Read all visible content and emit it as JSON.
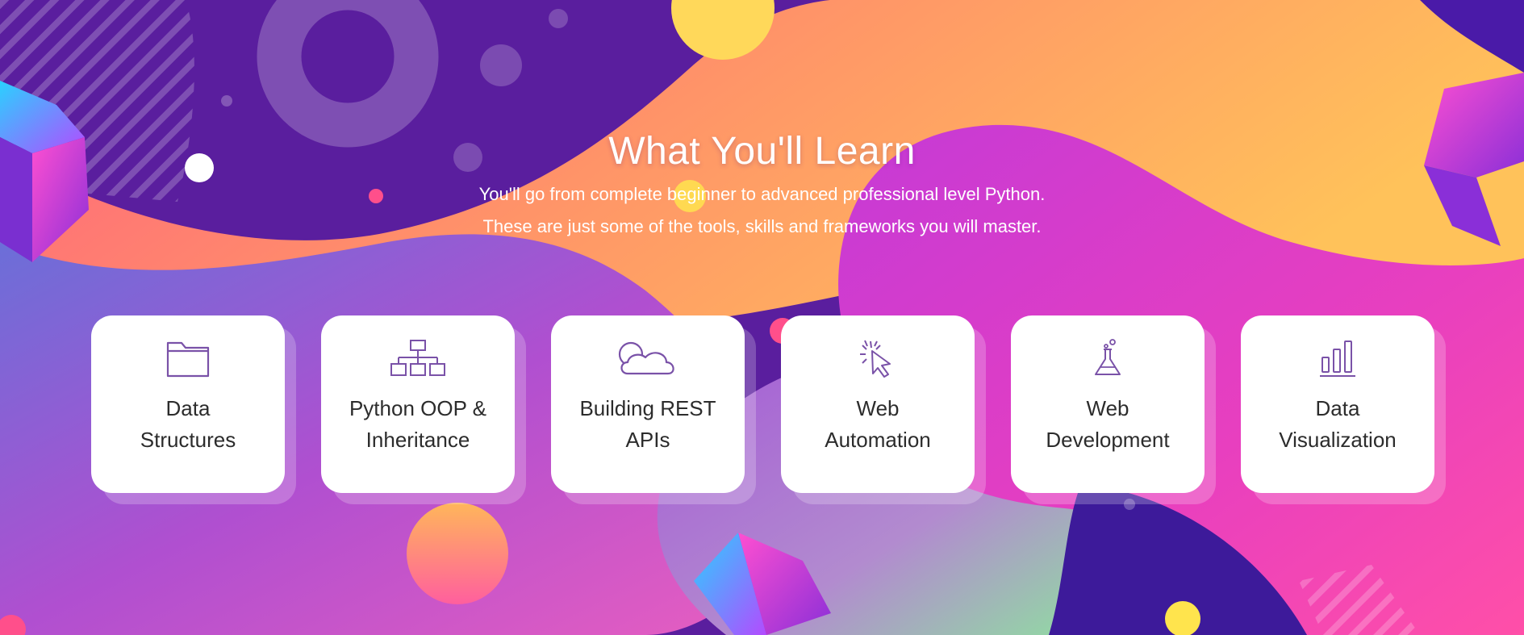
{
  "section": {
    "title": "What You'll Learn",
    "subtitle_line1": "You'll go from complete beginner to advanced professional level Python.",
    "subtitle_line2": "These are just some of the tools, skills and frameworks you will master."
  },
  "cards": [
    {
      "line1": "Data",
      "line2": "Structures",
      "icon": "folder-icon"
    },
    {
      "line1": "Python OOP &",
      "line2": "Inheritance",
      "icon": "hierarchy-icon"
    },
    {
      "line1": "Building REST",
      "line2": "APIs",
      "icon": "cloud-icon"
    },
    {
      "line1": "Web",
      "line2": "Automation",
      "icon": "cursor-click-icon"
    },
    {
      "line1": "Web",
      "line2": "Development",
      "icon": "flask-icon"
    },
    {
      "line1": "Data",
      "line2": "Visualization",
      "icon": "bar-chart-icon"
    }
  ],
  "colors": {
    "icon": "#7a52a8",
    "card_text": "#2c2c2c",
    "background_base": "#5a1e9e",
    "wave_orange": "#ff9a5e",
    "wave_magenta": "#e63cc4",
    "accent_yellow": "#ffe44d"
  }
}
